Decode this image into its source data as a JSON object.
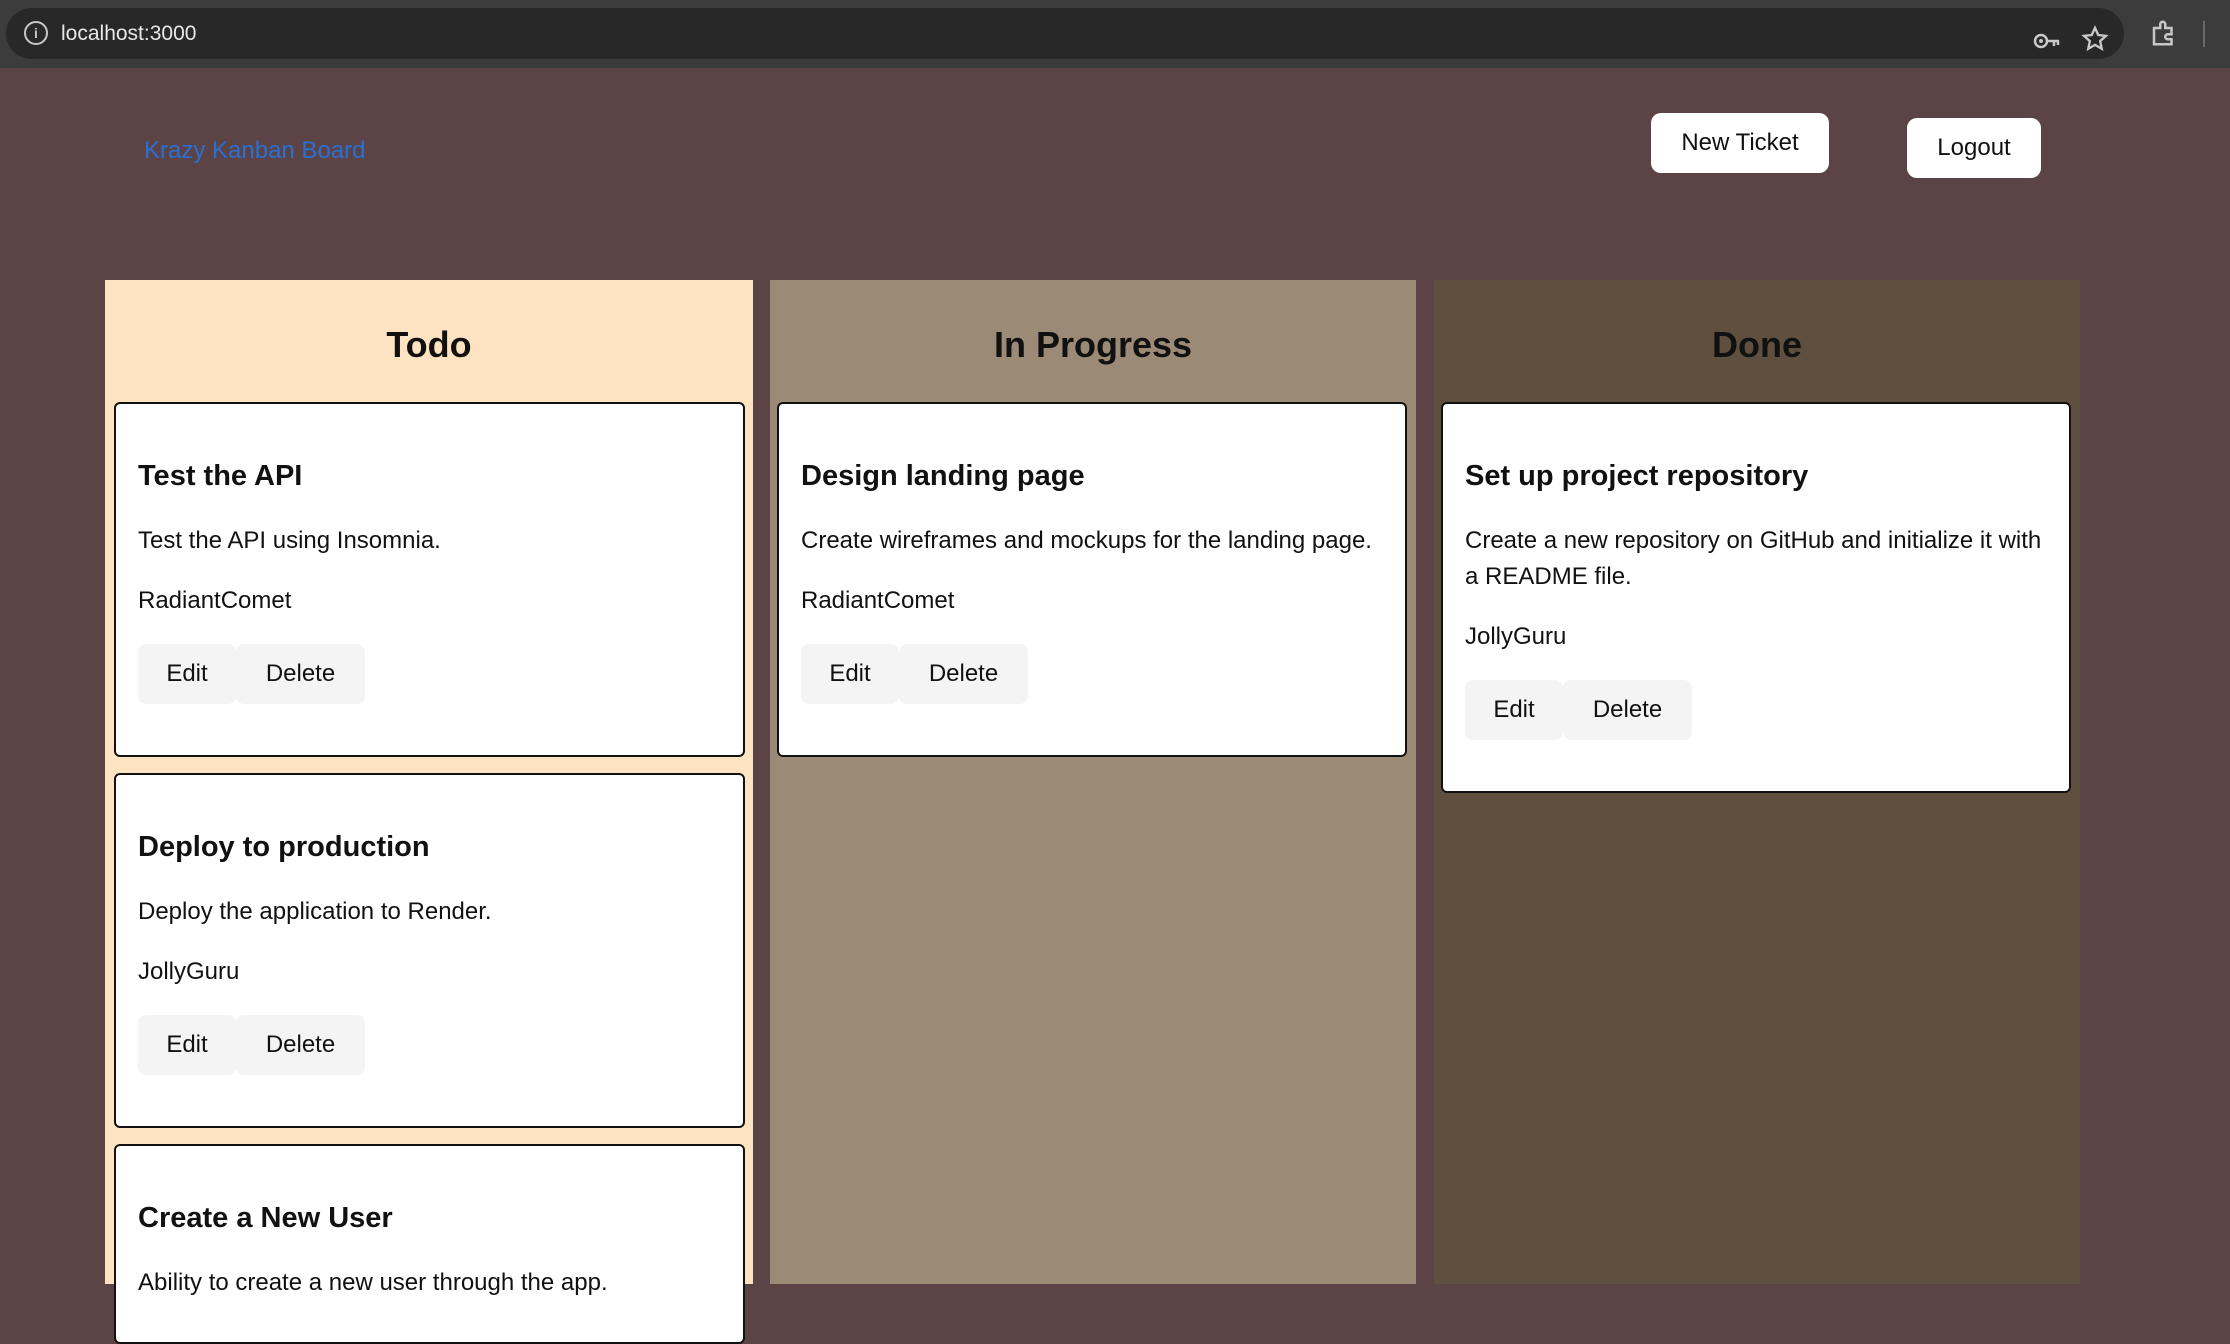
{
  "browser": {
    "url": "localhost:3000"
  },
  "header": {
    "brand": "Krazy Kanban Board",
    "new_ticket_label": "New Ticket",
    "logout_label": "Logout"
  },
  "columns": [
    {
      "title": "Todo",
      "color": "#fee3c3",
      "tickets": [
        {
          "title": "Test the API",
          "description": "Test the API using Insomnia.",
          "user": "RadiantComet",
          "edit": "Edit",
          "delete": "Delete"
        },
        {
          "title": "Deploy to production",
          "description": "Deploy the application to Render.",
          "user": "JollyGuru",
          "edit": "Edit",
          "delete": "Delete"
        },
        {
          "title": "Create a New User",
          "description": "Ability to create a new user through the app.",
          "user": "",
          "edit": "",
          "delete": ""
        }
      ]
    },
    {
      "title": "In Progress",
      "color": "#9b8a76",
      "tickets": [
        {
          "title": "Design landing page",
          "description": "Create wireframes and mockups for the landing page.",
          "user": "RadiantComet",
          "edit": "Edit",
          "delete": "Delete"
        }
      ]
    },
    {
      "title": "Done",
      "color": "#5e4f3e",
      "tickets": [
        {
          "title": "Set up project repository",
          "description": "Create a new repository on GitHub and initialize it with a README file.",
          "user": "JollyGuru",
          "edit": "Edit",
          "delete": "Delete"
        }
      ]
    }
  ],
  "colors": {
    "page_bg": "#5c4446",
    "brand": "#2a6fd4"
  }
}
